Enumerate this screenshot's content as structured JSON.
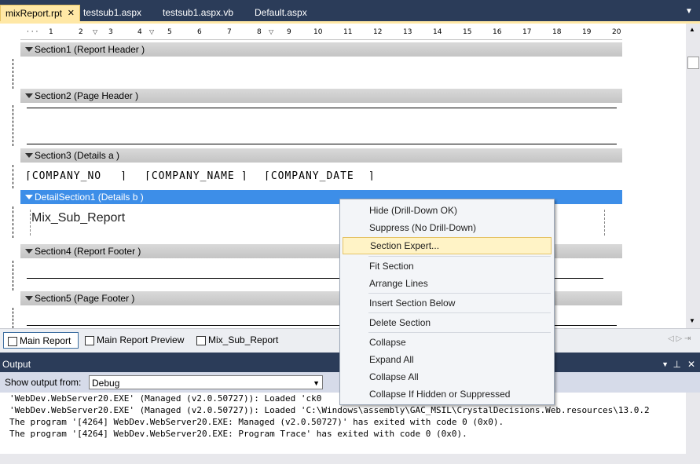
{
  "doc_tabs": [
    {
      "label": "mixReport.rpt",
      "active": true
    },
    {
      "label": "testsub1.aspx"
    },
    {
      "label": "testsub1.aspx.vb"
    },
    {
      "label": "Default.aspx"
    }
  ],
  "ruler": [
    "1",
    "2",
    "3",
    "4",
    "5",
    "6",
    "7",
    "8",
    "9",
    "10",
    "11",
    "12",
    "13",
    "14",
    "15",
    "16",
    "17",
    "18",
    "19",
    "20"
  ],
  "sections": [
    {
      "label": "Section1 (Report Header  )"
    },
    {
      "label": "Section2 (Page Header  )"
    },
    {
      "label": "Section3 (Details a )"
    },
    {
      "label": "DetailSection1 (Details b )"
    },
    {
      "label": "Section4 (Report Footer  )"
    },
    {
      "label": "Section5 (Page Footer  )"
    }
  ],
  "fields": {
    "company_no": "COMPANY_NO",
    "company_name": "COMPANY_NAME",
    "company_date": "COMPANY_DATE"
  },
  "subreport": "Mix_Sub_Report",
  "bottom_tabs": [
    {
      "label": "Main Report",
      "active": true
    },
    {
      "label": "Main Report Preview"
    },
    {
      "label": "Mix_Sub_Report"
    }
  ],
  "output": {
    "title": "Output",
    "show_from_label": "Show output from:",
    "source": "Debug",
    "lines": [
      "'WebDev.WebServer20.EXE' (Managed (v2.0.50727)): Loaded 'ck0",
      "'WebDev.WebServer20.EXE' (Managed (v2.0.50727)): Loaded 'C:\\Windows\\assembly\\GAC_MSIL\\CrystalDecisions.Web.resources\\13.0.2",
      "The program '[4264] WebDev.WebServer20.EXE: Managed (v2.0.50727)' has exited with code 0 (0x0).",
      "The program '[4264] WebDev.WebServer20.EXE: Program Trace' has exited with code 0 (0x0)."
    ]
  },
  "context_menu": [
    {
      "label": "Hide (Drill-Down OK)"
    },
    {
      "label": "Suppress (No Drill-Down)"
    },
    {
      "label": "Section Expert...",
      "highlighted": true
    },
    {
      "label": "Fit Section"
    },
    {
      "label": "Arrange Lines"
    },
    {
      "label": "Insert Section Below"
    },
    {
      "label": "Delete Section"
    },
    {
      "label": "Collapse"
    },
    {
      "label": "Expand All"
    },
    {
      "label": "Collapse All"
    },
    {
      "label": "Collapse If Hidden or Suppressed"
    }
  ],
  "colors": {
    "accent_tab": "#ffe8a6",
    "chrome": "#2b3c59",
    "selected_band": "#3d8ee8"
  }
}
